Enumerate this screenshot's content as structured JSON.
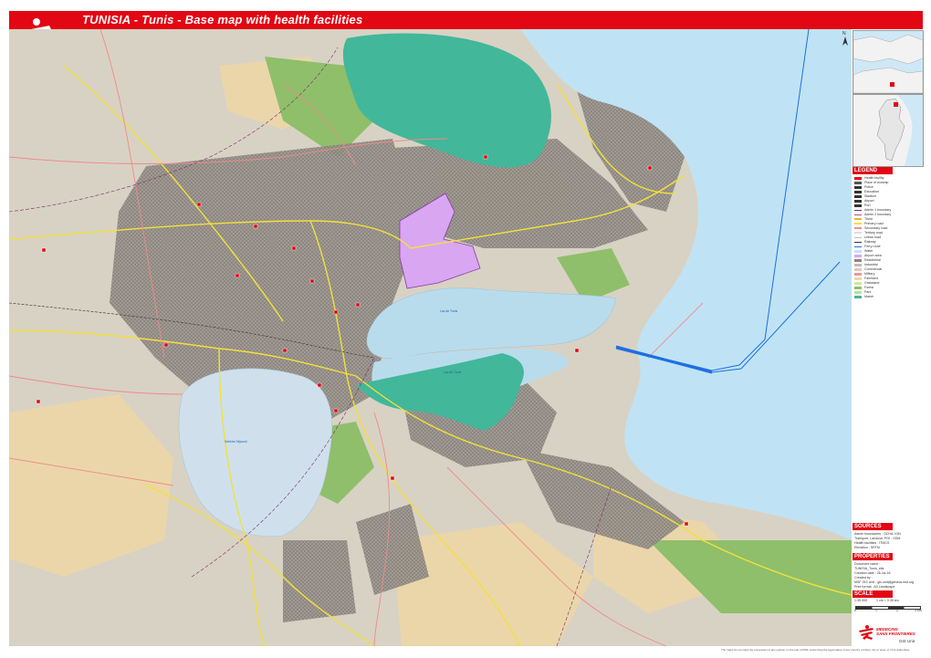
{
  "header": {
    "title": "TUNISIA - Tunis - Base map with health facilities",
    "brand_color": "#e30613"
  },
  "map": {
    "water_labels": [
      "Lac de Tunis",
      "Lac de Tunis",
      "Sebkha Séjoumi"
    ],
    "colors": {
      "sea": "#bfe3f5",
      "lagoon": "#b9dcec",
      "salt_flat": "#42b79a",
      "land": "#d8d2c4",
      "urban": "#8b8580",
      "airport": "#d9a6f2",
      "forest": "#8fbf6a",
      "agriculture": "#eed7a6",
      "major_road": "#f2e13a",
      "secondary_road": "#f08a8a",
      "ferry_route": "#1e6fe0"
    }
  },
  "north_arrow": "N",
  "legend": {
    "header": "LEGEND",
    "items": [
      {
        "label": "Health facility",
        "color": "#e30613"
      },
      {
        "label": "Place of worship",
        "color": "#555555"
      },
      {
        "label": "Police",
        "color": "#333333"
      },
      {
        "label": "Education",
        "color": "#333333"
      },
      {
        "label": "Stadium",
        "color": "#333333"
      },
      {
        "label": "Airport",
        "color": "#333333"
      },
      {
        "label": "Port",
        "color": "#333333"
      },
      {
        "label": "Admin 1 boundary",
        "color": "#7a2a6a"
      },
      {
        "label": "Admin 2 boundary",
        "color": "#9a5a8a"
      },
      {
        "label": "Trunk",
        "color": "#f2b134"
      },
      {
        "label": "Primary road",
        "color": "#f2e13a"
      },
      {
        "label": "Secondary road",
        "color": "#f08a8a"
      },
      {
        "label": "Tertiary road",
        "color": "#dddddd"
      },
      {
        "label": "Urban road",
        "color": "#bbbbbb"
      },
      {
        "label": "Railway",
        "color": "#333333"
      },
      {
        "label": "Ferry route",
        "color": "#1e6fe0"
      },
      {
        "label": "Water",
        "color": "#bfe3f5"
      },
      {
        "label": "Airport area",
        "color": "#d9a6f2"
      },
      {
        "label": "Residential",
        "color": "#8b8580"
      },
      {
        "label": "Industrial",
        "color": "#c9b8b8"
      },
      {
        "label": "Commercial",
        "color": "#e8c4b8"
      },
      {
        "label": "Military",
        "color": "#e89a9a"
      },
      {
        "label": "Farmland",
        "color": "#eed7a6"
      },
      {
        "label": "Grassland",
        "color": "#cde6a6"
      },
      {
        "label": "Forest",
        "color": "#8fbf6a"
      },
      {
        "label": "Park",
        "color": "#b8e0a0"
      },
      {
        "label": "Marsh",
        "color": "#42b79a"
      }
    ]
  },
  "sources": {
    "header": "SOURCES",
    "lines": [
      "Admin boundaries : OCHA, IGN",
      "Transport, Landuse, POI : OSM",
      "Health facilities : ITMCS",
      "Elevation : SRTM"
    ]
  },
  "properties": {
    "header": "PROPERTIES",
    "lines": [
      "Document name :",
      "TUNISIA_Tunis_ella",
      "Creation date : 26-Jul-16",
      "Created by :",
      "MSF GIS Unit - gis.unit@geneva.msf.org",
      "Print format : A3 Landscape"
    ]
  },
  "scale": {
    "header": "SCALE",
    "ratio": "1:35 000",
    "equivalence": "1 cm = 0.35 km",
    "ticks": [
      "0",
      "1",
      "2",
      "3 km"
    ]
  },
  "logo": {
    "line1": "MEDECINS",
    "line2": "SANS FRONTIERES"
  },
  "gis_unit": "GIS Unit",
  "footer": "The maps do not imply the expression of any opinion on the part of MSF concerning the legal status of any country, territory, city or area, or of its authorities."
}
